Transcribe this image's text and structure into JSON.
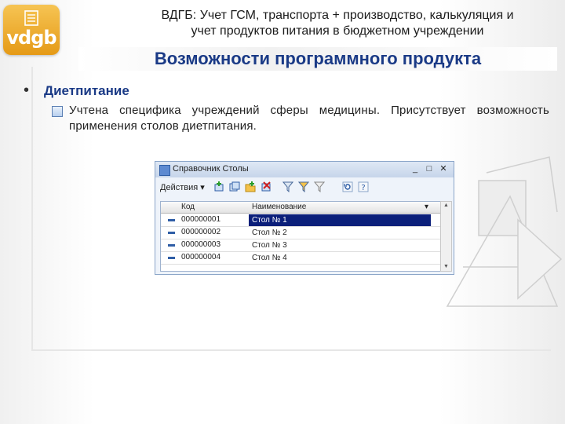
{
  "logo": {
    "text": "vdgb",
    "icon": "document-stack-icon"
  },
  "header": {
    "line1": "ВДГБ: Учет ГСМ, транспорта + производство, калькуляция и",
    "line2": "учет продуктов питания в бюджетном учреждении"
  },
  "title": "Возможности программного продукта",
  "section": {
    "bullet": "•",
    "heading": "Диетпитание",
    "description": "Учтена специфика учреждений сферы медицины. Присутствует возможность применения столов диетпитания."
  },
  "window": {
    "title": "Справочник Столы",
    "controls": [
      "_",
      "□",
      "✕"
    ],
    "toolbar": {
      "actions_label": "Действия",
      "icons": [
        "add-icon",
        "add-copy-icon",
        "add-group-icon",
        "delete-icon",
        "filter-icon",
        "filter-options-icon",
        "filter-clear-icon",
        "refresh-icon",
        "help-icon"
      ]
    },
    "grid": {
      "columns": [
        "Код",
        "Наименование"
      ],
      "rows": [
        {
          "code": "000000001",
          "name": "Стол № 1",
          "selected": true
        },
        {
          "code": "000000002",
          "name": "Стол № 2",
          "selected": false
        },
        {
          "code": "000000003",
          "name": "Стол № 3",
          "selected": false
        },
        {
          "code": "000000004",
          "name": "Стол № 4",
          "selected": false
        }
      ]
    }
  },
  "colors": {
    "title": "#1a3a86",
    "selection": "#0b1f7a",
    "logo": "#e59a17"
  }
}
